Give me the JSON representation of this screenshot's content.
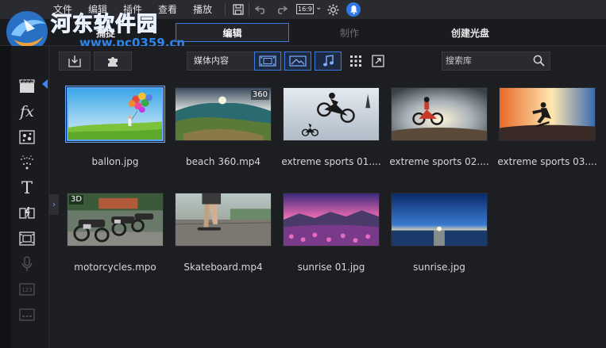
{
  "watermark": {
    "title": "河东软件园",
    "url": "www.pc0359.cn"
  },
  "menubar": {
    "items": [
      "文件",
      "编辑",
      "插件",
      "查看",
      "播放"
    ],
    "aspect_ratio": "16:9"
  },
  "modes": {
    "capture": "捕捉",
    "edit": "编辑",
    "produce": "制作",
    "create_disc": "创建光盘"
  },
  "toolbar": {
    "dropdown_value": "媒体内容",
    "search_placeholder": "搜索库"
  },
  "library": {
    "items": [
      {
        "name": "ballon.jpg",
        "selected": true,
        "badge": ""
      },
      {
        "name": "beach 360.mp4",
        "selected": false,
        "badge": "360"
      },
      {
        "name": "extreme sports 01....",
        "selected": false,
        "badge": ""
      },
      {
        "name": "extreme sports 02....",
        "selected": false,
        "badge": ""
      },
      {
        "name": "extreme sports 03....",
        "selected": false,
        "badge": ""
      },
      {
        "name": "motorcycles.mpo",
        "selected": false,
        "badge": "3D"
      },
      {
        "name": "Skateboard.mp4",
        "selected": false,
        "badge": ""
      },
      {
        "name": "sunrise 01.jpg",
        "selected": false,
        "badge": ""
      },
      {
        "name": "sunrise.jpg",
        "selected": false,
        "badge": ""
      }
    ]
  },
  "colors": {
    "accent": "#3c7be0",
    "background": "#1d1e22",
    "panel": "#2a2b30"
  }
}
